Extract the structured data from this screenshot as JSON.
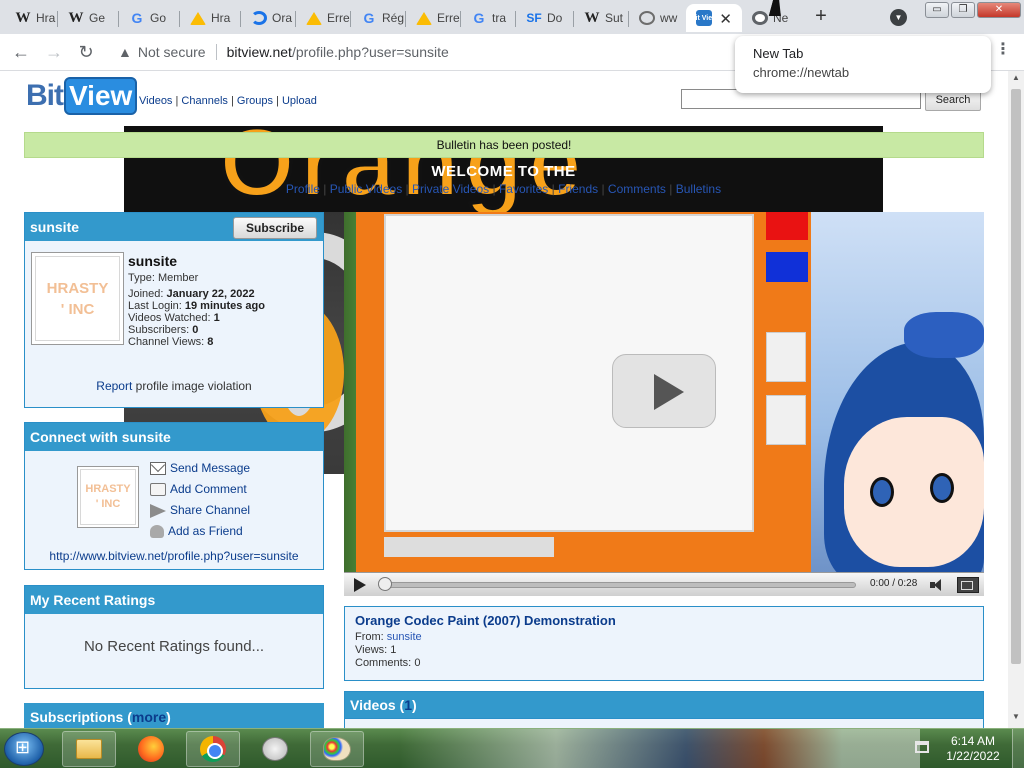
{
  "browser": {
    "tabs": [
      {
        "icon": "wikipedia-icon",
        "title": "Hra"
      },
      {
        "icon": "wikipedia-icon",
        "title": "Ge"
      },
      {
        "icon": "google-drive-icon",
        "title": "Go"
      },
      {
        "icon": "google-drive-icon",
        "title": "Hra"
      },
      {
        "icon": "orange-site-icon",
        "title": "Ora"
      },
      {
        "icon": "google-drive-icon",
        "title": "Erre"
      },
      {
        "icon": "google-icon",
        "title": "Rég"
      },
      {
        "icon": "google-drive-icon",
        "title": "Erre"
      },
      {
        "icon": "google-icon",
        "title": "tra"
      },
      {
        "icon": "sourceforge-icon",
        "title": "Do"
      },
      {
        "icon": "wikipedia-icon",
        "title": "Sut"
      },
      {
        "icon": "globe-icon",
        "title": "ww"
      },
      {
        "icon": "bitview-icon",
        "title": ""
      },
      {
        "icon": "chrome-icon",
        "title": "Ne"
      }
    ],
    "fav_letters": {
      "w": "W",
      "g": "G",
      "sf": "SF",
      "bv": "Bit View"
    },
    "tab_close": "✕",
    "new_tab_symbol": "+",
    "back_symbol": "←",
    "forward_symbol": "→",
    "reload_symbol": "↻",
    "warning_symbol": "▲",
    "security_label": "Not secure",
    "url_host": "bitview.net",
    "url_path": "/profile.php?user=sunsite",
    "menu_symbol": "⋮",
    "tab_search_symbol": "▼",
    "window_buttons": {
      "minimize": "▭",
      "restore": "❐",
      "close": "✕"
    },
    "hover_card": {
      "title": "New Tab",
      "url": "chrome://newtab"
    }
  },
  "site": {
    "logo_bit": "Bit",
    "logo_view": "View",
    "nav": [
      "Videos",
      "Channels",
      "Groups",
      "Upload"
    ],
    "nav_separator": "|",
    "search_button": "Search"
  },
  "banner": {
    "text_fragment": "Orange",
    "notice": "Bulletin has been posted!",
    "welcome": "WELCOME TO THE",
    "profile_nav": [
      "Profile",
      "Public Videos",
      "Private Videos",
      "Favorites",
      "Friends",
      "Comments",
      "Bulletins"
    ]
  },
  "profile": {
    "header": "sunsite",
    "subscribe": "Subscribe",
    "avatar_text": [
      "HRASTY",
      "' INC"
    ],
    "name": "sunsite",
    "type_label": "Type:",
    "type_value": "Member",
    "joined_label": "Joined:",
    "joined_value": "January 22, 2022",
    "last_login_label": "Last Login:",
    "last_login_value": "19 minutes ago",
    "videos_watched_label": "Videos Watched:",
    "videos_watched_value": "1",
    "subscribers_label": "Subscribers:",
    "subscribers_value": "0",
    "channel_views_label": "Channel Views:",
    "channel_views_value": "8",
    "report_link": "Report",
    "report_rest": "profile image violation"
  },
  "connect": {
    "header": "Connect with sunsite",
    "avatar_text": [
      "HRASTY",
      "' INC"
    ],
    "send_message": "Send Message",
    "add_comment": "Add Comment",
    "share_channel": "Share Channel",
    "add_friend": "Add as Friend",
    "channel_url": "http://www.bitview.net/profile.php?user=sunsite"
  },
  "ratings": {
    "header": "My Recent Ratings",
    "empty": "No Recent Ratings found..."
  },
  "subscriptions": {
    "header": "Subscriptions (",
    "more": "more",
    "close": ")"
  },
  "player": {
    "time": "0:00 / 0:28",
    "progress_fraction": 0
  },
  "video_info": {
    "title": "Orange Codec Paint (2007) Demonstration",
    "from_label": "From:",
    "from_user": "sunsite",
    "views_label": "Views:",
    "views_value": "1",
    "comments_label": "Comments:",
    "comments_value": "0"
  },
  "videos": {
    "header": "Videos (",
    "count": "1",
    "close": ")"
  },
  "taskbar": {
    "time": "6:14 AM",
    "date": "1/22/2022"
  }
}
